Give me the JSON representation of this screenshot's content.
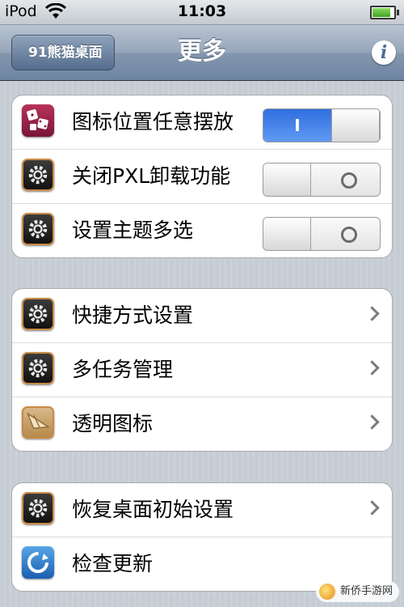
{
  "status_bar": {
    "carrier": "iPod",
    "time": "11:03"
  },
  "nav": {
    "back_label": "91熊猫桌面",
    "title": "更多",
    "info_label": "i"
  },
  "groups": [
    {
      "rows": [
        {
          "label": "图标位置任意摆放",
          "icon": "dice-icon",
          "control": "switch",
          "state": "on",
          "switch_text": "I"
        },
        {
          "label": "关闭PXL卸载功能",
          "icon": "gear-icon",
          "control": "switch",
          "state": "off"
        },
        {
          "label": "设置主题多选",
          "icon": "gear-icon",
          "control": "switch",
          "state": "off"
        }
      ]
    },
    {
      "rows": [
        {
          "label": "快捷方式设置",
          "icon": "gear-icon",
          "control": "chevron"
        },
        {
          "label": "多任务管理",
          "icon": "gear-icon",
          "control": "chevron"
        },
        {
          "label": "透明图标",
          "icon": "notification-icon",
          "control": "chevron"
        }
      ]
    },
    {
      "rows": [
        {
          "label": "恢复桌面初始设置",
          "icon": "gear-icon",
          "control": "chevron"
        },
        {
          "label": "检查更新",
          "icon": "update-icon",
          "control": "none"
        }
      ]
    }
  ],
  "watermark": "新侨手游网",
  "colors": {
    "switch_on": "#2f6fe0",
    "nav_bar": "#6d84a2",
    "background": "#c5ccd4"
  }
}
